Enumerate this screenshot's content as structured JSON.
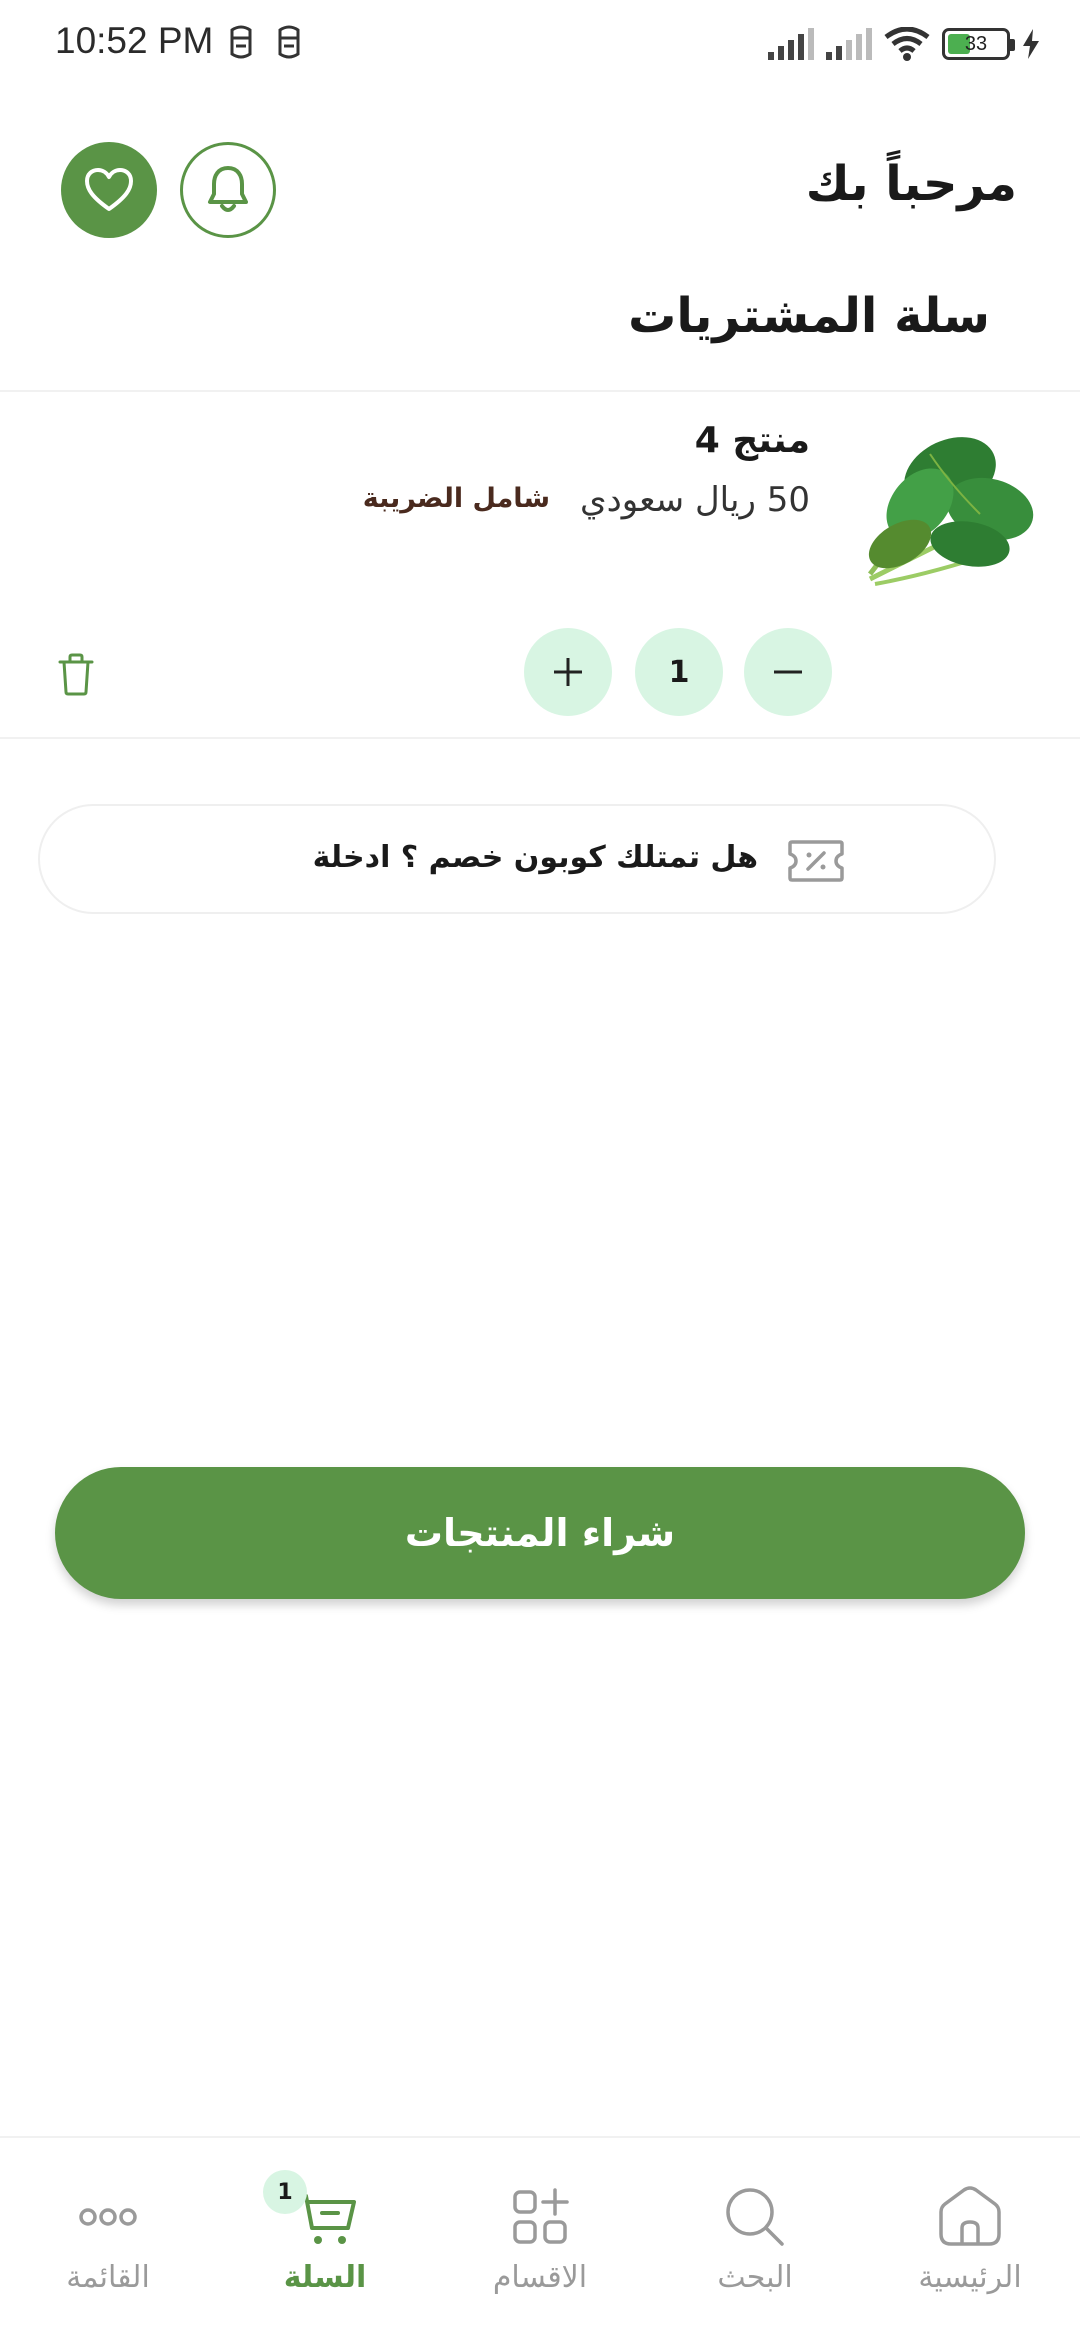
{
  "status_bar": {
    "time": "10:52 PM",
    "battery_level": "33",
    "icons": [
      "notification-glyph-icon",
      "notification-glyph-icon",
      "signal-icon",
      "signal-icon",
      "wifi-icon",
      "battery-icon",
      "charging-icon"
    ]
  },
  "header": {
    "greeting": "مرحباً بك",
    "favorites_icon": "heart-icon",
    "notifications_icon": "bell-icon"
  },
  "page": {
    "title": "سلة المشتريات"
  },
  "cart": {
    "items": [
      {
        "name": "منتج 4",
        "price": "50 ريال سعودي",
        "tax_note": "شامل الضريبة",
        "quantity": "1",
        "image": "spinach-image"
      }
    ]
  },
  "coupon": {
    "text": "هل تمتلك كوبون خصم ؟ ادخلة",
    "icon": "discount-ticket-icon"
  },
  "checkout": {
    "label": "شراء المنتجات"
  },
  "bottom_nav": {
    "items": [
      {
        "label": "القائمة",
        "icon": "more-icon",
        "active": false
      },
      {
        "label": "السلة",
        "icon": "cart-icon",
        "active": true,
        "badge": "1"
      },
      {
        "label": "الاقسام",
        "icon": "categories-icon",
        "active": false
      },
      {
        "label": "البحث",
        "icon": "search-icon",
        "active": false
      },
      {
        "label": "الرئيسية",
        "icon": "home-icon",
        "active": false
      }
    ]
  },
  "colors": {
    "accent": "#5a9446",
    "accent_light": "#d8f5e3",
    "tax_text": "#4a2a1e",
    "inactive": "#9a9a9a"
  }
}
